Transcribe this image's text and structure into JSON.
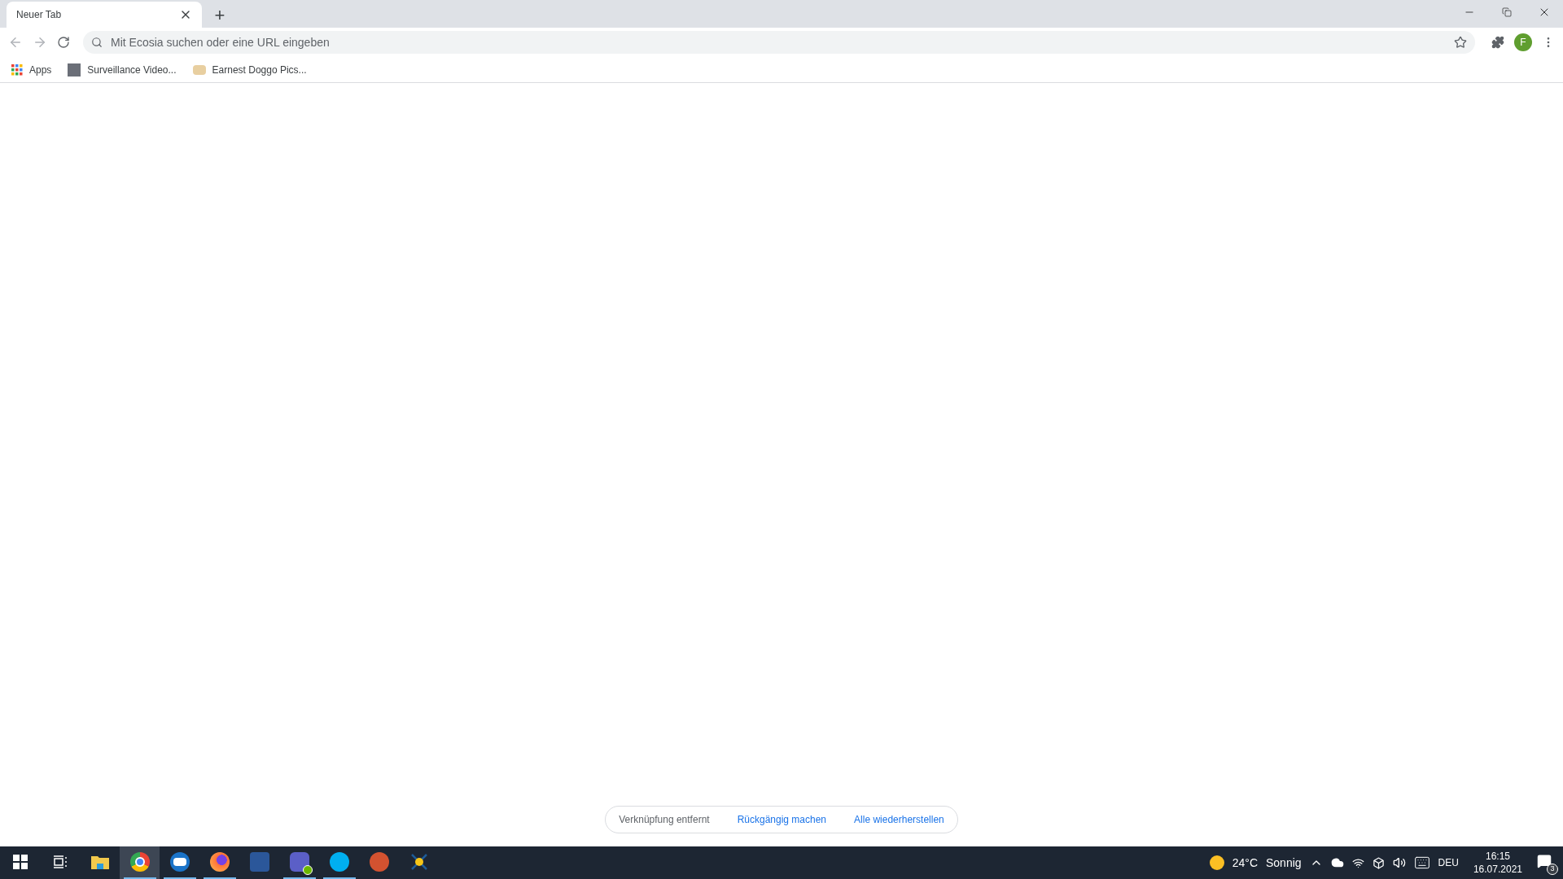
{
  "tabs": [
    {
      "title": "Neuer Tab",
      "selected": true
    }
  ],
  "new_tab": "+",
  "address_bar": {
    "placeholder": "Mit Ecosia suchen oder eine URL eingeben"
  },
  "profile": {
    "initial": "F"
  },
  "bookmarks": [
    {
      "label": "Apps",
      "kind": "apps"
    },
    {
      "label": "Surveillance Video...",
      "kind": "photo"
    },
    {
      "label": "Earnest Doggo Pics...",
      "kind": "favicon"
    }
  ],
  "toast": {
    "message": "Verknüpfung entfernt",
    "actions": [
      "Rückgängig machen",
      "Alle wiederherstellen"
    ]
  },
  "taskbar": {
    "apps": [
      {
        "kind": "start",
        "running": false,
        "selected": false
      },
      {
        "kind": "taskview",
        "running": false,
        "selected": false
      },
      {
        "kind": "explorer",
        "running": false,
        "selected": false
      },
      {
        "kind": "chrome",
        "running": true,
        "selected": true
      },
      {
        "kind": "mail",
        "running": true,
        "selected": false
      },
      {
        "kind": "firefox",
        "running": true,
        "selected": false
      },
      {
        "kind": "word",
        "running": false,
        "selected": false
      },
      {
        "kind": "teams",
        "running": true,
        "selected": false
      },
      {
        "kind": "skype",
        "running": true,
        "selected": false
      },
      {
        "kind": "powerpoint",
        "running": false,
        "selected": false
      },
      {
        "kind": "other",
        "running": false,
        "selected": false
      }
    ],
    "weather": {
      "temperature": "24°C",
      "condition": "Sonnig"
    },
    "language": "DEU",
    "time": "16:15",
    "date": "16.07.2021",
    "notifications": "3"
  }
}
